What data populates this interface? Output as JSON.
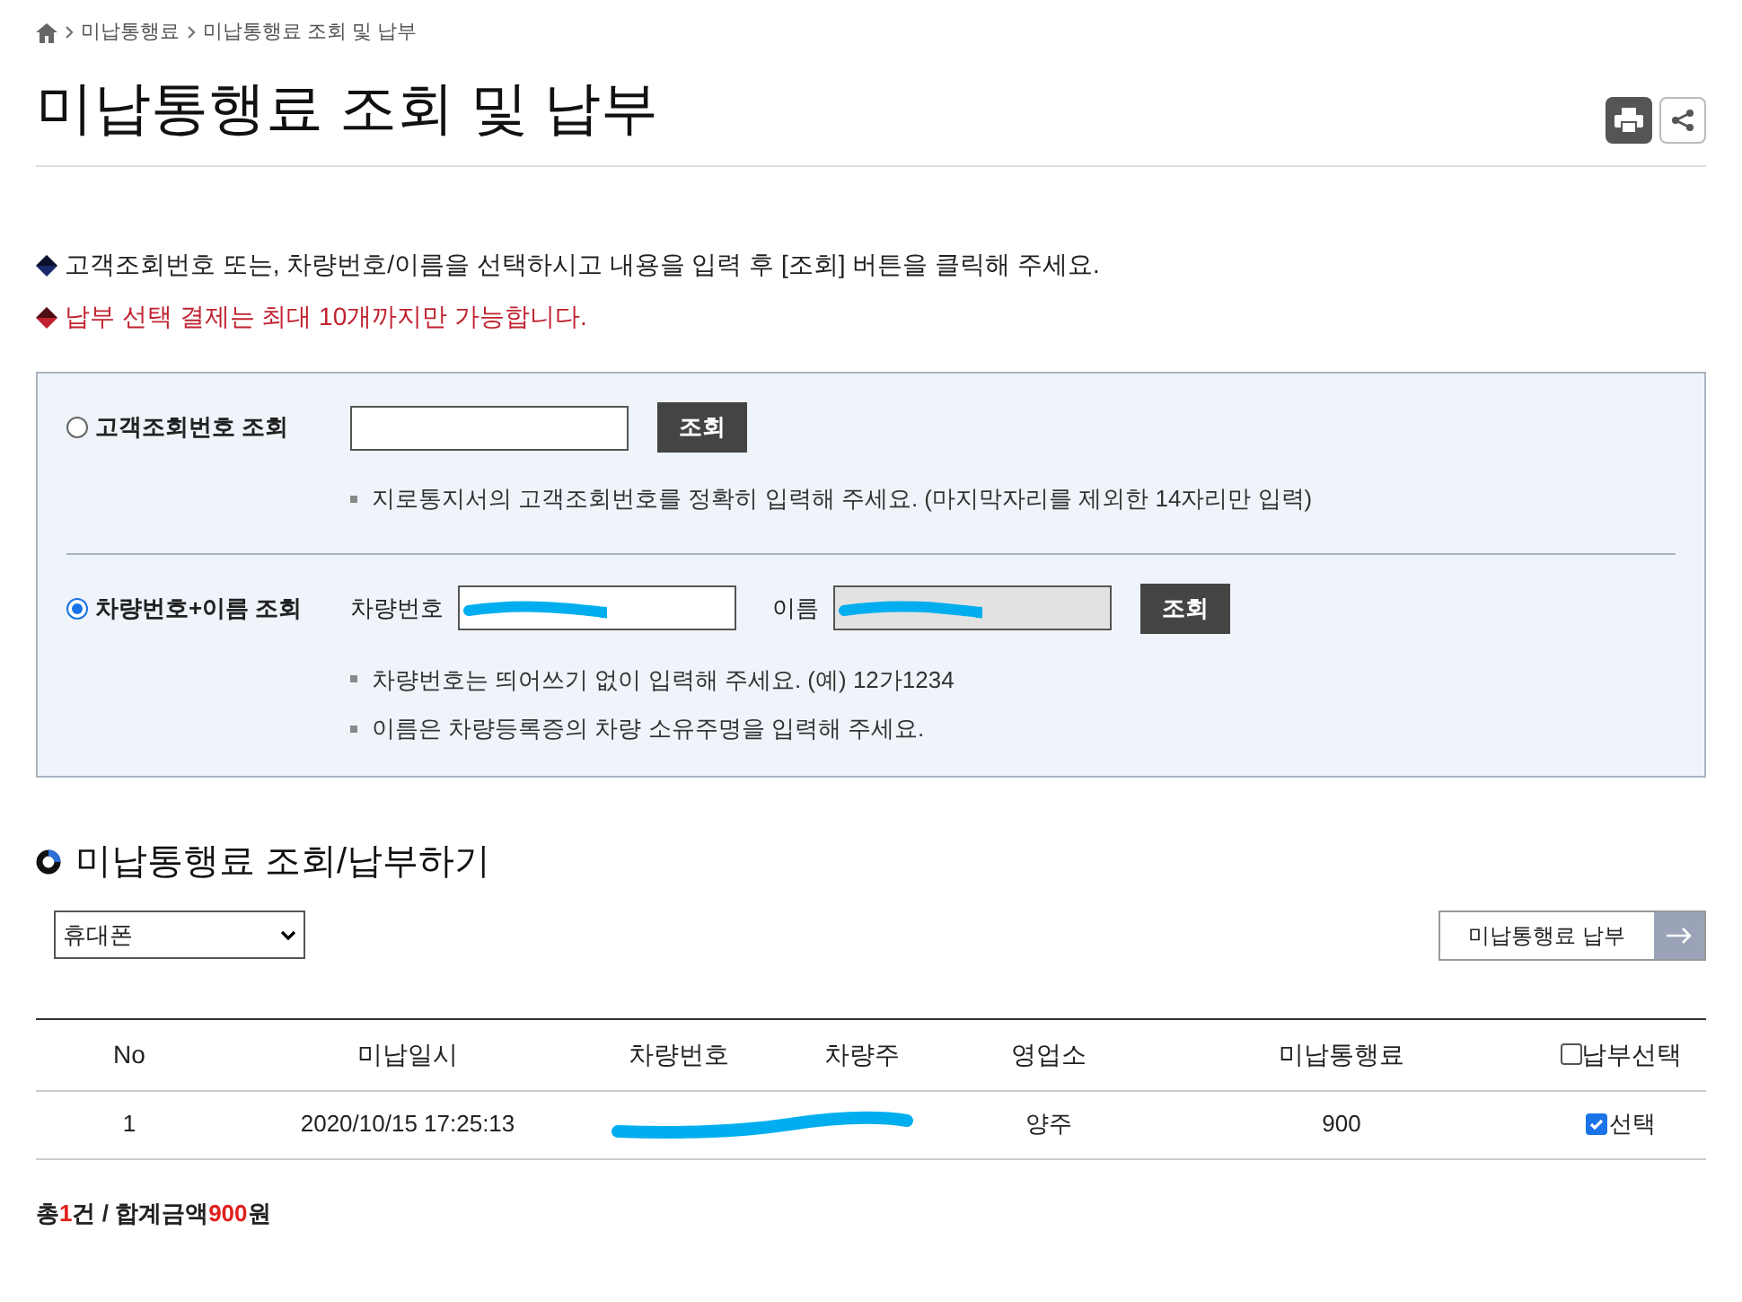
{
  "breadcrumb": [
    "미납통행료",
    "미납통행료 조회 및 납부"
  ],
  "title": "미납통행료 조회 및 납부",
  "notices": [
    {
      "kind": "normal",
      "text": "고객조회번호 또는, 차량번호/이름을 선택하시고 내용을 입력 후 [조회] 버튼을 클릭해 주세요."
    },
    {
      "kind": "warning",
      "text": "납부 선택 결제는 최대 10개까지만 가능합니다."
    }
  ],
  "search_options": [
    {
      "label": "고객조회번호 조회",
      "selected": false,
      "fields": [
        {
          "disabled": false
        }
      ],
      "button": "조회",
      "hints": [
        "지로통지서의 고객조회번호를 정확히 입력해 주세요. (마지막자리를 제외한 14자리만 입력)"
      ]
    },
    {
      "label": "차량번호+이름 조회",
      "selected": true,
      "fields": [
        {
          "label": "차량번호",
          "disabled": false,
          "redacted": true
        },
        {
          "label": "이름",
          "disabled": true,
          "redacted": true
        }
      ],
      "button": "조회",
      "hints": [
        "차량번호는 띄어쓰기 없이 입력해 주세요. (예) 12가1234",
        "이름은 차량등록증의 차량 소유주명을 입력해 주세요."
      ]
    }
  ],
  "section_title": "미납통행료 조회/납부하기",
  "payment_method": "휴대폰",
  "pay_button": "미납통행료 납부",
  "table": {
    "columns": [
      "No",
      "미납일시",
      "차량번호",
      "차량주",
      "영업소",
      "미납통행료",
      "납부선택"
    ],
    "select_all_checked": false,
    "rows": [
      {
        "no": "1",
        "date": "2020/10/15  17:25:13",
        "office": "양주",
        "amount": "900",
        "select_label": "선택",
        "checked": true
      }
    ]
  },
  "summary": {
    "prefix": "총",
    "count": "1",
    "middle": "건 / 합계금액",
    "amount": "900",
    "suffix": "원"
  }
}
